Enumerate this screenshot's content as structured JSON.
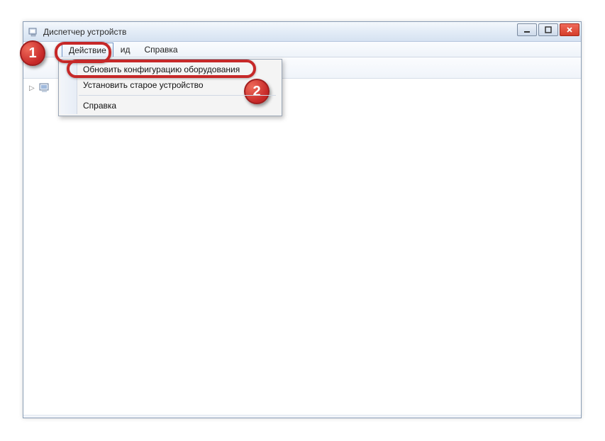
{
  "window": {
    "title": "Диспетчер устройств"
  },
  "menubar": {
    "action": "Действие",
    "view_partial": "ид",
    "help": "Справка"
  },
  "dropdown": {
    "item_scan": "Обновить конфигурацию оборудования",
    "item_legacy": "Установить старое устройство",
    "item_help": "Справка"
  },
  "badges": {
    "one": "1",
    "two": "2"
  }
}
